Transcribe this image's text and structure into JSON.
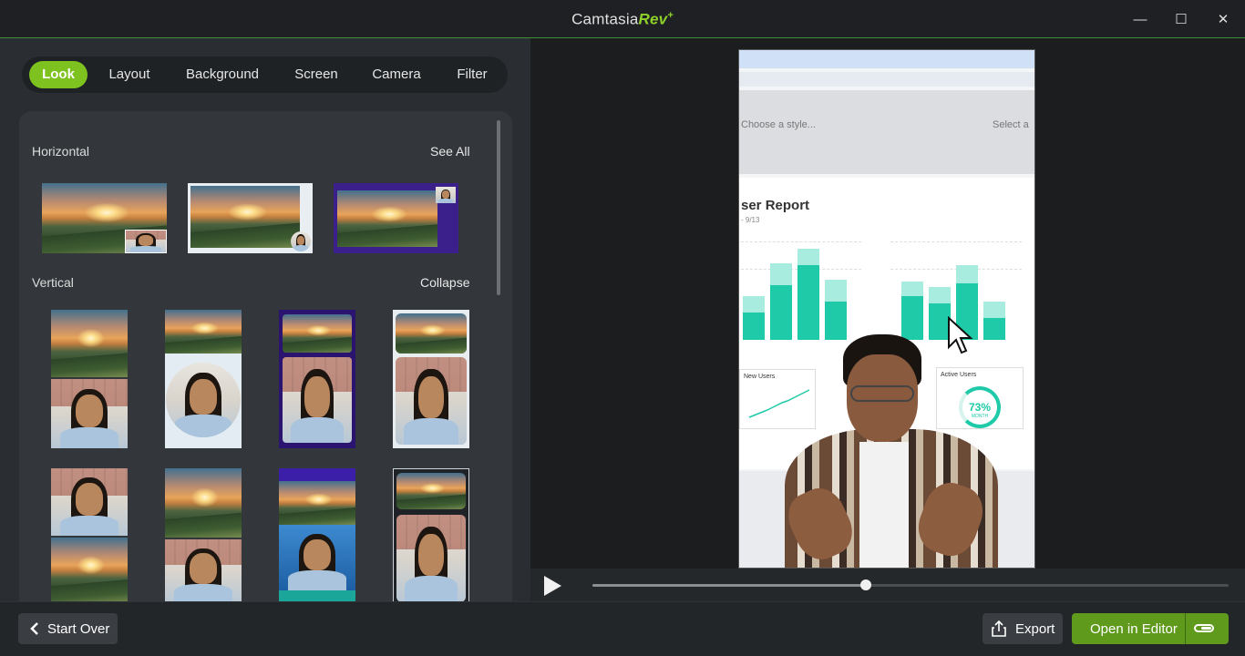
{
  "app": {
    "title_main": "Camtasia",
    "title_accent": "Rev",
    "title_mark": "+"
  },
  "window_controls": {
    "minimize": "—",
    "maximize": "☐",
    "close": "✕"
  },
  "tabs": [
    {
      "label": "Look",
      "active": true
    },
    {
      "label": "Layout",
      "active": false
    },
    {
      "label": "Background",
      "active": false
    },
    {
      "label": "Screen",
      "active": false
    },
    {
      "label": "Camera",
      "active": false
    },
    {
      "label": "Filter",
      "active": false
    }
  ],
  "gallery": {
    "horizontal_label": "Horizontal",
    "horizontal_link": "See All",
    "vertical_label": "Vertical",
    "vertical_link": "Collapse"
  },
  "preview": {
    "choose_style": "Choose a style...",
    "select_a": "Select a",
    "report_title": "ser Report",
    "report_dates": "- 9/13",
    "card_new_users": "New Users",
    "card_active_users": "Active Users",
    "gauge_value": "73%",
    "gauge_caption": "MONTH",
    "progress": 0.43
  },
  "bottom": {
    "start_over": "Start Over",
    "export": "Export",
    "open_in_editor": "Open in Editor"
  },
  "colors": {
    "accent": "#7dc21e",
    "primary_button": "#5f9a1c",
    "teal": "#1fcaa8"
  }
}
